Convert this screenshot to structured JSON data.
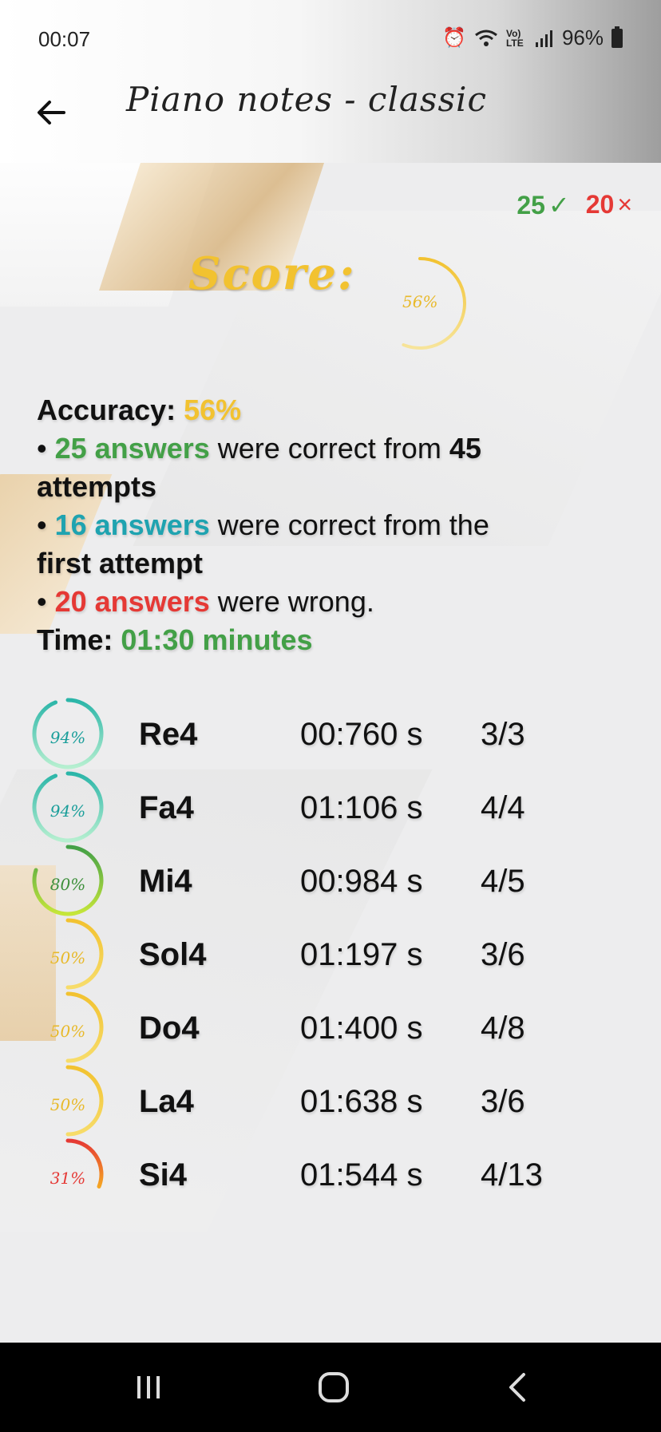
{
  "status_bar": {
    "time": "00:07",
    "battery": "96%",
    "network": "Vo) LTE"
  },
  "header": {
    "title": "Piano notes - classic"
  },
  "counts": {
    "correct": "25",
    "correct_mark": "✓",
    "wrong": "20",
    "wrong_mark": "×"
  },
  "score": {
    "label": "Score:",
    "value": "56%",
    "fraction": 0.56,
    "color": "#f2c230"
  },
  "stats": {
    "accuracy_label": "Accuracy:",
    "accuracy_value": "56%",
    "bullet1_highlight": "25 answers",
    "bullet1_text": " were correct from ",
    "bullet1_total": "45",
    "bullet1_tail": "attempts",
    "bullet2_highlight": "16 answers",
    "bullet2_text": " were correct from the ",
    "bullet2_tail": "first attempt",
    "bullet3_highlight": "20 answers",
    "bullet3_text": " were wrong.",
    "time_label": "Time:",
    "time_value": "01:30 minutes"
  },
  "notes": [
    {
      "pct": "94%",
      "fraction": 0.94,
      "color": "#2ab5a8",
      "start_color": "#b6efd0",
      "text_color": "#1a9e9a",
      "name": "Re4",
      "time": "00:760 s",
      "frac": "3/3"
    },
    {
      "pct": "94%",
      "fraction": 0.94,
      "color": "#2ab5a8",
      "start_color": "#b6efd0",
      "text_color": "#1a9e9a",
      "name": "Fa4",
      "time": "01:106 s",
      "frac": "4/4"
    },
    {
      "pct": "80%",
      "fraction": 0.8,
      "color": "#43a047",
      "start_color": "#c6e63a",
      "text_color": "#3d8f3a",
      "name": "Mi4",
      "time": "00:984 s",
      "frac": "4/5"
    },
    {
      "pct": "50%",
      "fraction": 0.5,
      "color": "#f2c230",
      "start_color": "#f7dc6a",
      "text_color": "#e8b92a",
      "name": "Sol4",
      "time": "01:197 s",
      "frac": "3/6"
    },
    {
      "pct": "50%",
      "fraction": 0.5,
      "color": "#f2c230",
      "start_color": "#f7dc6a",
      "text_color": "#e8b92a",
      "name": "Do4",
      "time": "01:400 s",
      "frac": "4/8"
    },
    {
      "pct": "50%",
      "fraction": 0.5,
      "color": "#f2c230",
      "start_color": "#f7dc6a",
      "text_color": "#e8b92a",
      "name": "La4",
      "time": "01:638 s",
      "frac": "3/6"
    },
    {
      "pct": "31%",
      "fraction": 0.31,
      "color": "#e53935",
      "start_color": "#f5a623",
      "text_color": "#e53935",
      "name": "Si4",
      "time": "01:544 s",
      "frac": "4/13"
    }
  ]
}
